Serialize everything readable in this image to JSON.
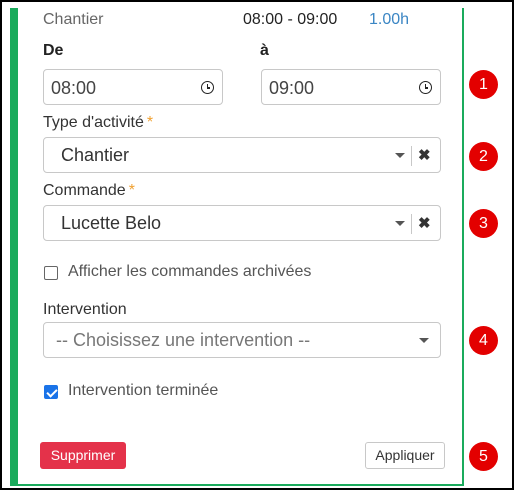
{
  "header": {
    "activity_name": "Chantier",
    "time_range": "08:00 - 09:00",
    "duration": "1.00h"
  },
  "time": {
    "from_label": "De",
    "to_label": "à",
    "from_value": "08:00",
    "to_value": "09:00"
  },
  "activity_type": {
    "label": "Type d'activité",
    "required_mark": "*",
    "selected": "Chantier",
    "clear_symbol": "✖"
  },
  "order": {
    "label": "Commande",
    "required_mark": "*",
    "selected": "Lucette Belo",
    "clear_symbol": "✖"
  },
  "archived_orders": {
    "label": "Afficher les commandes archivées",
    "checked": false
  },
  "intervention": {
    "label": "Intervention",
    "placeholder": "-- Choisissez une intervention --"
  },
  "intervention_done": {
    "label": "Intervention terminée",
    "checked": true
  },
  "actions": {
    "delete_label": "Supprimer",
    "apply_label": "Appliquer"
  },
  "markers": [
    "1",
    "2",
    "3",
    "4",
    "5"
  ],
  "colors": {
    "panel_border": "#1aab5c",
    "duration_text": "#3b86c4",
    "required_mark": "#f0a030",
    "delete_button": "#e4324a",
    "marker_circle": "#e30000",
    "checkbox_checked": "#1a73e8"
  }
}
